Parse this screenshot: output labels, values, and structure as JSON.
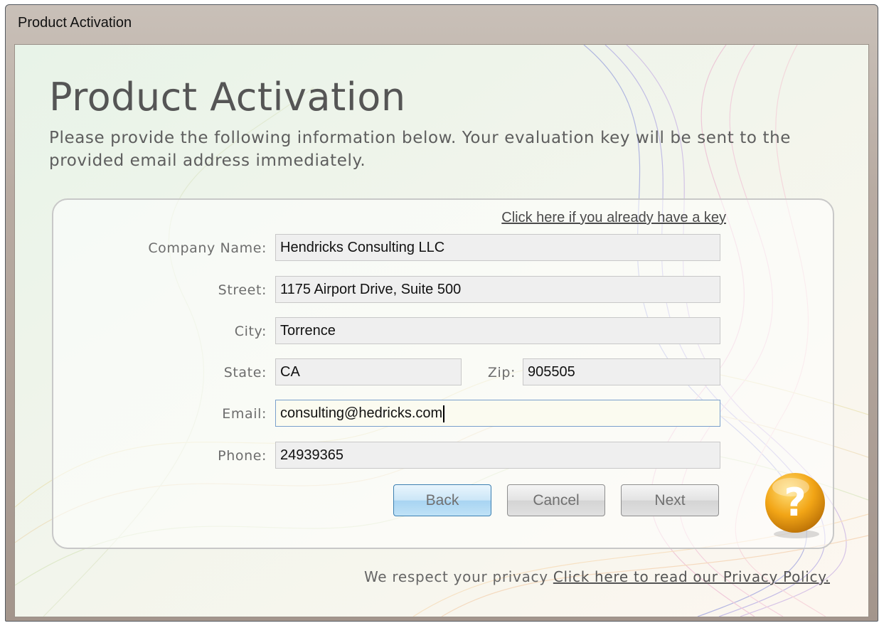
{
  "window": {
    "title": "Product Activation"
  },
  "header": {
    "title": "Product Activation",
    "description": "Please provide the following information below. Your evaluation key will be sent to the provided email address immediately."
  },
  "form": {
    "already_have_key_link": "Click here if you already have a key",
    "company": {
      "label": "Company Name:",
      "value": "Hendricks Consulting LLC"
    },
    "street": {
      "label": "Street:",
      "value": "1175 Airport Drive, Suite 500"
    },
    "city": {
      "label": "City:",
      "value": "Torrence"
    },
    "state": {
      "label": "State:",
      "value": "CA"
    },
    "zip": {
      "label": "Zip:",
      "value": "905505"
    },
    "email": {
      "label": "Email:",
      "value": "consulting@hedricks.com"
    },
    "phone": {
      "label": "Phone:",
      "value": "24939365"
    }
  },
  "buttons": {
    "back": "Back",
    "cancel": "Cancel",
    "next": "Next"
  },
  "help": {
    "glyph": "?",
    "icon": "question-mark-icon",
    "color": "#f2a516"
  },
  "footer": {
    "privacy_text": "We respect your privacy",
    "privacy_link": "Click here to read our Privacy Policy."
  }
}
